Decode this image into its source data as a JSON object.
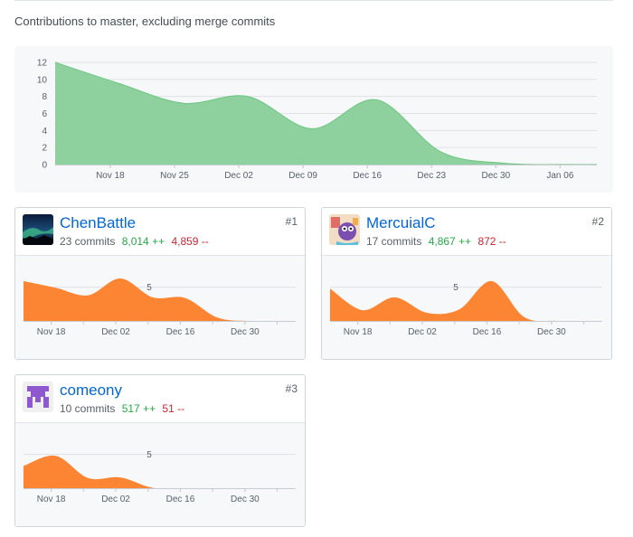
{
  "page": {
    "subtitle": "Contributions to master, excluding merge commits"
  },
  "colors": {
    "main_area": "#8fd19e",
    "main_line": "#6cc681",
    "contributor_area": "#fb8532",
    "link": "#0366d6",
    "additions": "#28a745",
    "deletions": "#cb2431",
    "panel_bg": "#f6f8fa"
  },
  "chart_data": [
    {
      "name": "contributions-overview",
      "type": "area",
      "title": "",
      "xlabel": "",
      "ylabel": "",
      "x_ticks": [
        "Nov 18",
        "Nov 25",
        "Dec 02",
        "Dec 09",
        "Dec 16",
        "Dec 23",
        "Dec 30",
        "Jan 06"
      ],
      "y_ticks": [
        0,
        2,
        4,
        6,
        8,
        10,
        12
      ],
      "ylim": [
        0,
        12
      ],
      "grid": true,
      "legend": "none",
      "series": [
        {
          "x": [
            "Nov 12",
            "Nov 19",
            "Nov 26",
            "Dec 03",
            "Dec 10",
            "Dec 17",
            "Dec 24",
            "Dec 31",
            "Jan 07",
            "Jan 10"
          ],
          "values": [
            12,
            9.5,
            7.2,
            8,
            4.2,
            7.6,
            1.5,
            0.15,
            0,
            0
          ]
        }
      ]
    },
    {
      "name": "ChenBattle",
      "type": "area",
      "x_ticks": [
        "Nov 18",
        "Dec 02",
        "Dec 16",
        "Dec 30"
      ],
      "y_ticks": [
        5
      ],
      "ylim": [
        0,
        7.5
      ],
      "series": [
        {
          "x": [
            "Nov 12",
            "Nov 19",
            "Nov 26",
            "Dec 03",
            "Dec 10",
            "Dec 17",
            "Dec 24",
            "Dec 31",
            "Jan 07",
            "Jan 10"
          ],
          "values": [
            5.9,
            4.9,
            3.8,
            6.3,
            3.5,
            3.4,
            0.5,
            0,
            0,
            0
          ]
        }
      ]
    },
    {
      "name": "MercuialC",
      "type": "area",
      "x_ticks": [
        "Nov 18",
        "Dec 02",
        "Dec 16",
        "Dec 30"
      ],
      "y_ticks": [
        5
      ],
      "ylim": [
        0,
        7.5
      ],
      "series": [
        {
          "x": [
            "Nov 12",
            "Nov 19",
            "Nov 26",
            "Dec 03",
            "Dec 10",
            "Dec 17",
            "Dec 24",
            "Dec 31",
            "Jan 07",
            "Jan 10"
          ],
          "values": [
            4.8,
            1.6,
            3.5,
            1.2,
            1.7,
            5.9,
            0.6,
            0,
            0,
            0
          ]
        }
      ]
    },
    {
      "name": "comeony",
      "type": "area",
      "x_ticks": [
        "Nov 18",
        "Dec 02",
        "Dec 16",
        "Dec 30"
      ],
      "y_ticks": [
        5
      ],
      "ylim": [
        0,
        7.5
      ],
      "series": [
        {
          "x": [
            "Nov 12",
            "Nov 19",
            "Nov 26",
            "Dec 03",
            "Dec 10",
            "Dec 17",
            "Dec 24",
            "Dec 31",
            "Jan 07",
            "Jan 10"
          ],
          "values": [
            3.3,
            4.8,
            1.5,
            1.6,
            0.05,
            0,
            0,
            0,
            0,
            0
          ]
        }
      ]
    }
  ],
  "contributors": [
    {
      "username": "ChenBattle",
      "commits": "23 commits",
      "additions": "8,014 ++",
      "deletions": "4,859 --",
      "rank": "#1"
    },
    {
      "username": "MercuialC",
      "commits": "17 commits",
      "additions": "4,867 ++",
      "deletions": "872 --",
      "rank": "#2"
    },
    {
      "username": "comeony",
      "commits": "10 commits",
      "additions": "517 ++",
      "deletions": "51 --",
      "rank": "#3"
    }
  ]
}
